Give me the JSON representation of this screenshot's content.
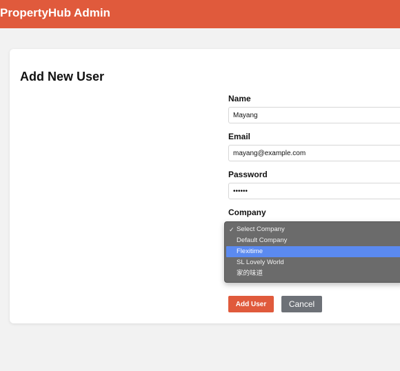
{
  "app": {
    "title": "PropertyHub Admin"
  },
  "form": {
    "title": "Add New User",
    "fields": {
      "name": {
        "label": "Name",
        "value": "Mayang"
      },
      "email": {
        "label": "Email",
        "value": "mayang@example.com"
      },
      "password": {
        "label": "Password",
        "value": "••••••"
      },
      "company": {
        "label": "Company",
        "selected": "Select Company",
        "highlighted": "Flexitime",
        "options": [
          {
            "label": "Select Company",
            "checked": true
          },
          {
            "label": "Default Company",
            "checked": false
          },
          {
            "label": "Flexitime",
            "checked": false
          },
          {
            "label": "SL Lovely World",
            "checked": false
          },
          {
            "label": "家的味道",
            "checked": false
          }
        ]
      }
    },
    "buttons": {
      "add": "Add User",
      "cancel": "Cancel"
    }
  },
  "icons": {
    "checkmark": "✓"
  },
  "colors": {
    "brand": "#e05a3c",
    "secondary_button": "#6d7177",
    "dropdown_bg": "#6b6b6b",
    "dropdown_highlight": "#5b8af0"
  }
}
